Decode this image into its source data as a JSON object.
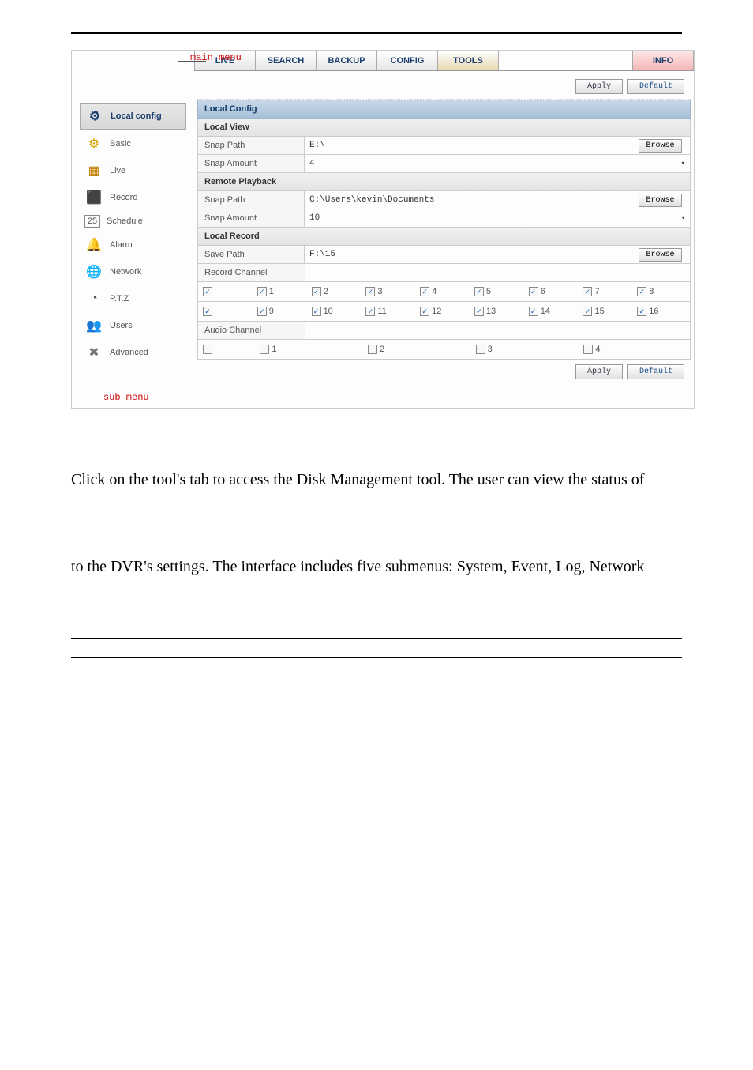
{
  "labels": {
    "main_menu": "main menu",
    "sub_menu": "sub menu"
  },
  "tabs": [
    "LIVE",
    "SEARCH",
    "BACKUP",
    "CONFIG",
    "TOOLS",
    "INFO"
  ],
  "active_tab": 3,
  "buttons": {
    "apply": "Apply",
    "default": "Default",
    "browse": "Browse"
  },
  "nav": [
    {
      "label": "Local config",
      "active": true
    },
    {
      "label": "Basic"
    },
    {
      "label": "Live"
    },
    {
      "label": "Record"
    },
    {
      "label": "Schedule"
    },
    {
      "label": "Alarm"
    },
    {
      "label": "Network"
    },
    {
      "label": "P.T.Z"
    },
    {
      "label": "Users"
    },
    {
      "label": "Advanced"
    }
  ],
  "nav_icons": [
    "⚙",
    "⚙",
    "▦",
    "⬛",
    "25",
    "🔔",
    "🌐",
    "◔",
    "👥",
    "✖"
  ],
  "panel_title": "Local Config",
  "sections": {
    "local_view": {
      "title": "Local View",
      "snap_path_label": "Snap Path",
      "snap_path_value": "E:\\",
      "snap_amount_label": "Snap Amount",
      "snap_amount_value": "4"
    },
    "remote_playback": {
      "title": "Remote Playback",
      "snap_path_label": "Snap Path",
      "snap_path_value": "C:\\Users\\kevin\\Documents",
      "snap_amount_label": "Snap Amount",
      "snap_amount_value": "10"
    },
    "local_record": {
      "title": "Local Record",
      "save_path_label": "Save Path",
      "save_path_value": "F:\\15",
      "record_channel_label": "Record Channel",
      "audio_channel_label": "Audio Channel"
    }
  },
  "record_channels": {
    "row1": [
      "1",
      "2",
      "3",
      "4",
      "5",
      "6",
      "7",
      "8"
    ],
    "row2": [
      "9",
      "10",
      "11",
      "12",
      "13",
      "14",
      "15",
      "16"
    ]
  },
  "audio_channels": [
    "1",
    "2",
    "3",
    "4"
  ],
  "body": {
    "p1": "Click on the tool's tab to access the Disk Management tool. The user can view the status of",
    "p2": "to the DVR's settings. The interface includes five submenus: System, Event, Log, Network"
  }
}
